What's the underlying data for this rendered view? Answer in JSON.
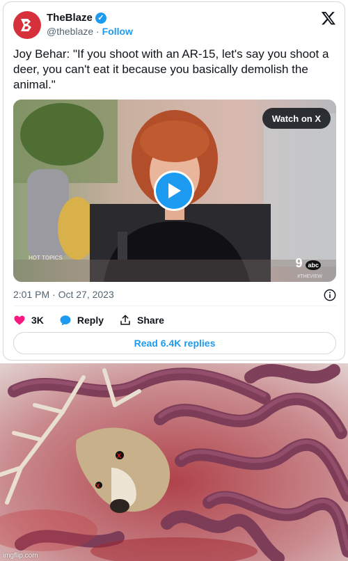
{
  "tweet": {
    "author_name": "TheBlaze",
    "handle": "@theblaze",
    "separator": "·",
    "follow_label": "Follow",
    "text": "Joy Behar: \"If you shoot with an AR-15, let's say you shoot a deer, you can't eat it because you basically demolish the animal.\"",
    "timestamp": "2:01 PM · Oct 27, 2023",
    "likes_count": "3K",
    "reply_label": "Reply",
    "share_label": "Share",
    "read_replies_label": "Read 6.4K replies"
  },
  "media": {
    "watch_label": "Watch on X",
    "show_logo_text": "HOT TOPICS",
    "channel_text": "9",
    "channel_badge": "abc",
    "channel_sub": "#THEVIEW"
  },
  "meme": {
    "watermark": "imgflip.com"
  },
  "colors": {
    "accent": "#1d9bf0",
    "like": "#f91880",
    "brand_red": "#d6313a"
  }
}
